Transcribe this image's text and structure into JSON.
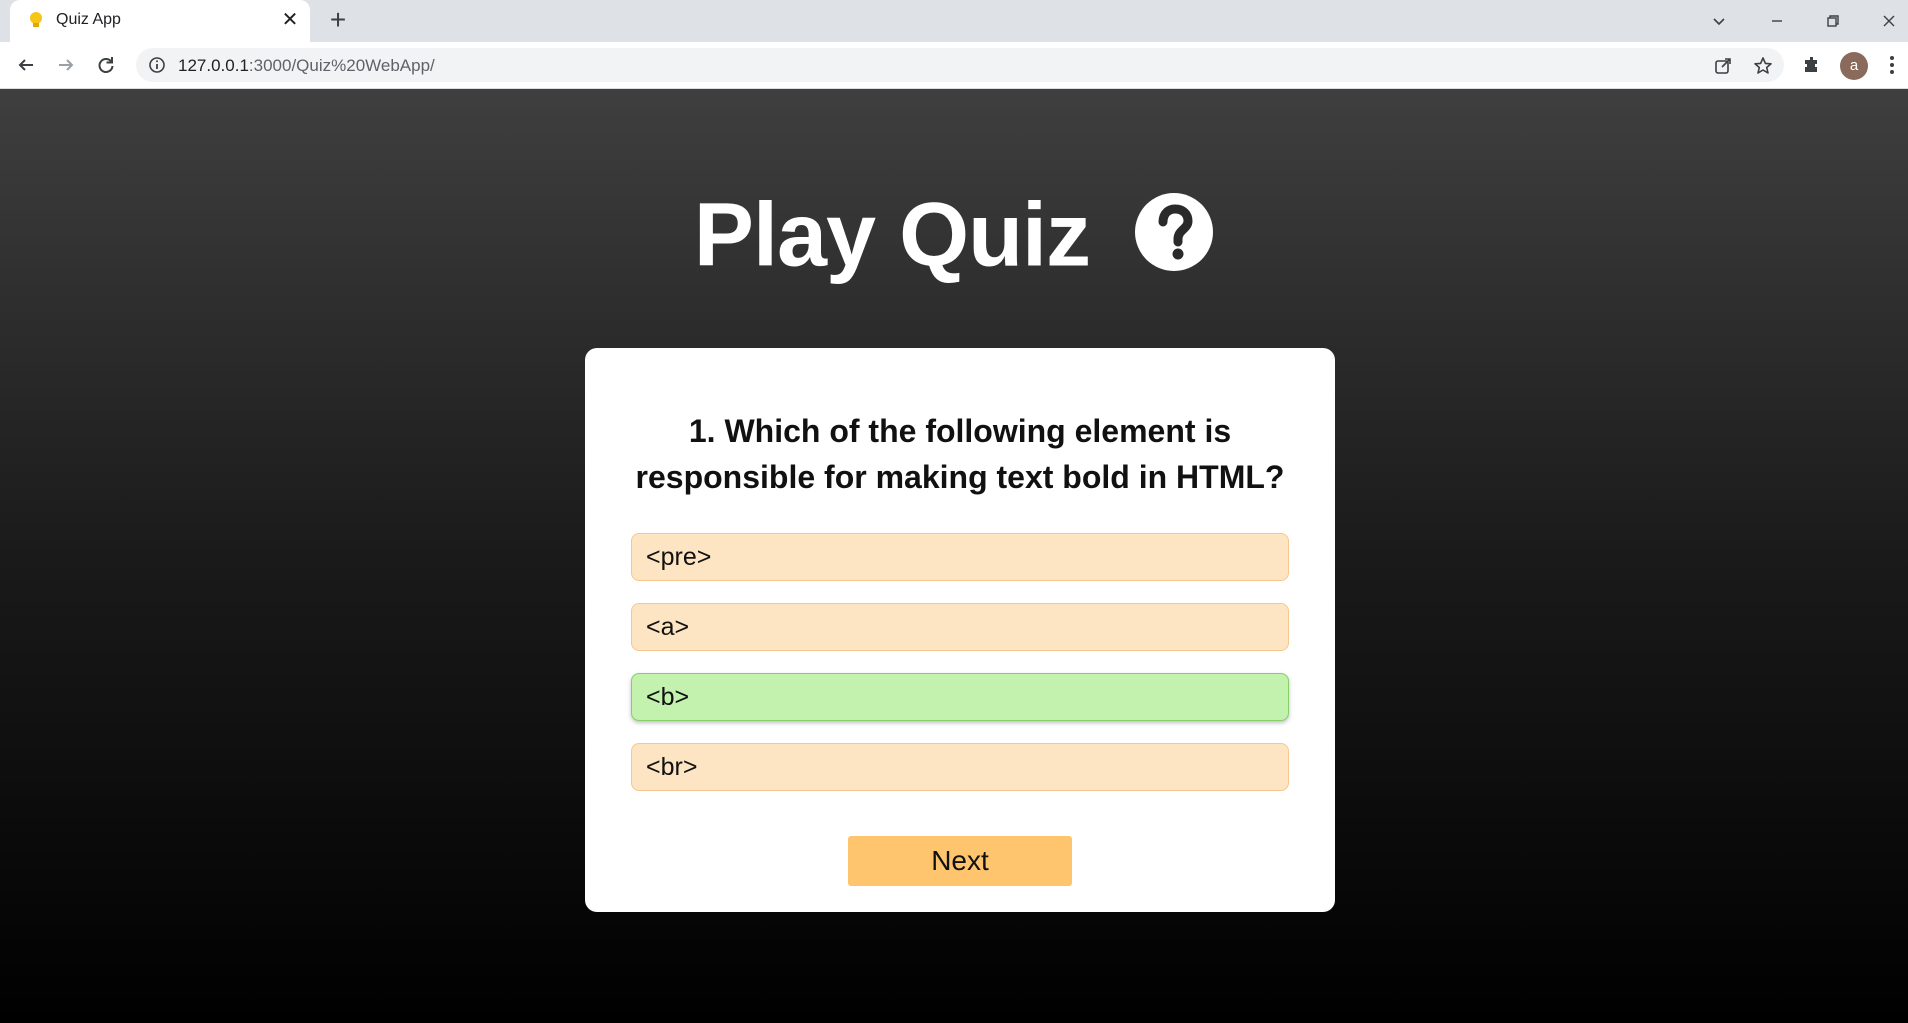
{
  "browser": {
    "tab_title": "Quiz App",
    "new_tab_label": "+",
    "url_host": "127.0.0.1",
    "url_rest": ":3000/Quiz%20WebApp/",
    "avatar_letter": "a"
  },
  "page": {
    "heading": "Play Quiz",
    "question": "1. Which of the following element is responsible for making text bold in HTML?",
    "options": [
      {
        "label": "<pre>",
        "state": "default"
      },
      {
        "label": "<a>",
        "state": "default"
      },
      {
        "label": "<b>",
        "state": "correct"
      },
      {
        "label": "<br>",
        "state": "default"
      }
    ],
    "next_label": "Next"
  },
  "colors": {
    "option_bg": "#fde5c3",
    "option_correct_bg": "#c2f2ae",
    "next_bg": "#fec46e"
  },
  "icons": [
    "bulb-favicon-icon",
    "close-icon",
    "plus-icon",
    "chevron-down-icon",
    "minimize-icon",
    "restore-icon",
    "window-close-icon",
    "back-arrow-icon",
    "forward-arrow-icon",
    "reload-icon",
    "info-icon",
    "share-icon",
    "star-icon",
    "extensions-icon",
    "more-menu-icon",
    "question-circle-icon"
  ]
}
